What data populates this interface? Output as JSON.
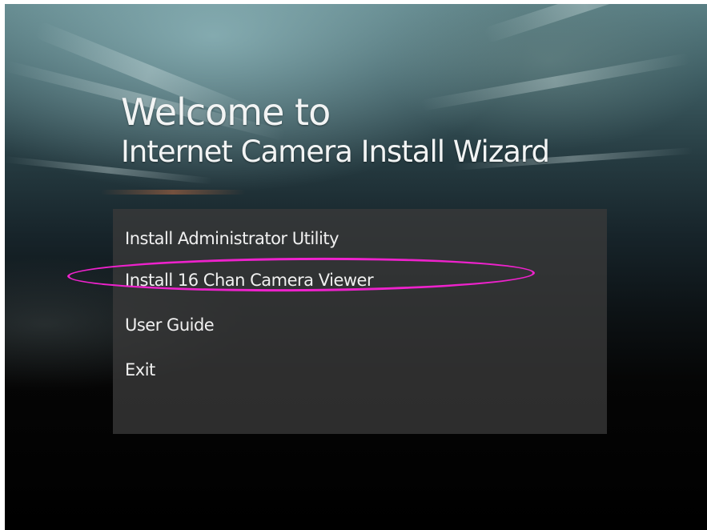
{
  "window": {
    "title_line_1": "Welcome to",
    "title_line_2": "Internet Camera Install Wizard"
  },
  "menu": {
    "items": [
      {
        "label": "Install Administrator Utility"
      },
      {
        "label": "Install 16 Chan Camera Viewer"
      },
      {
        "label": "User Guide"
      },
      {
        "label": "Exit"
      }
    ]
  },
  "annotation": {
    "highlighted_item": "Install 16 Chan Camera Viewer",
    "color": "#ee22cc"
  },
  "colors": {
    "text": "#f0f0f0",
    "panel": "#3a3a3a",
    "background_dark": "#000000",
    "background_light": "#5a7f84"
  }
}
